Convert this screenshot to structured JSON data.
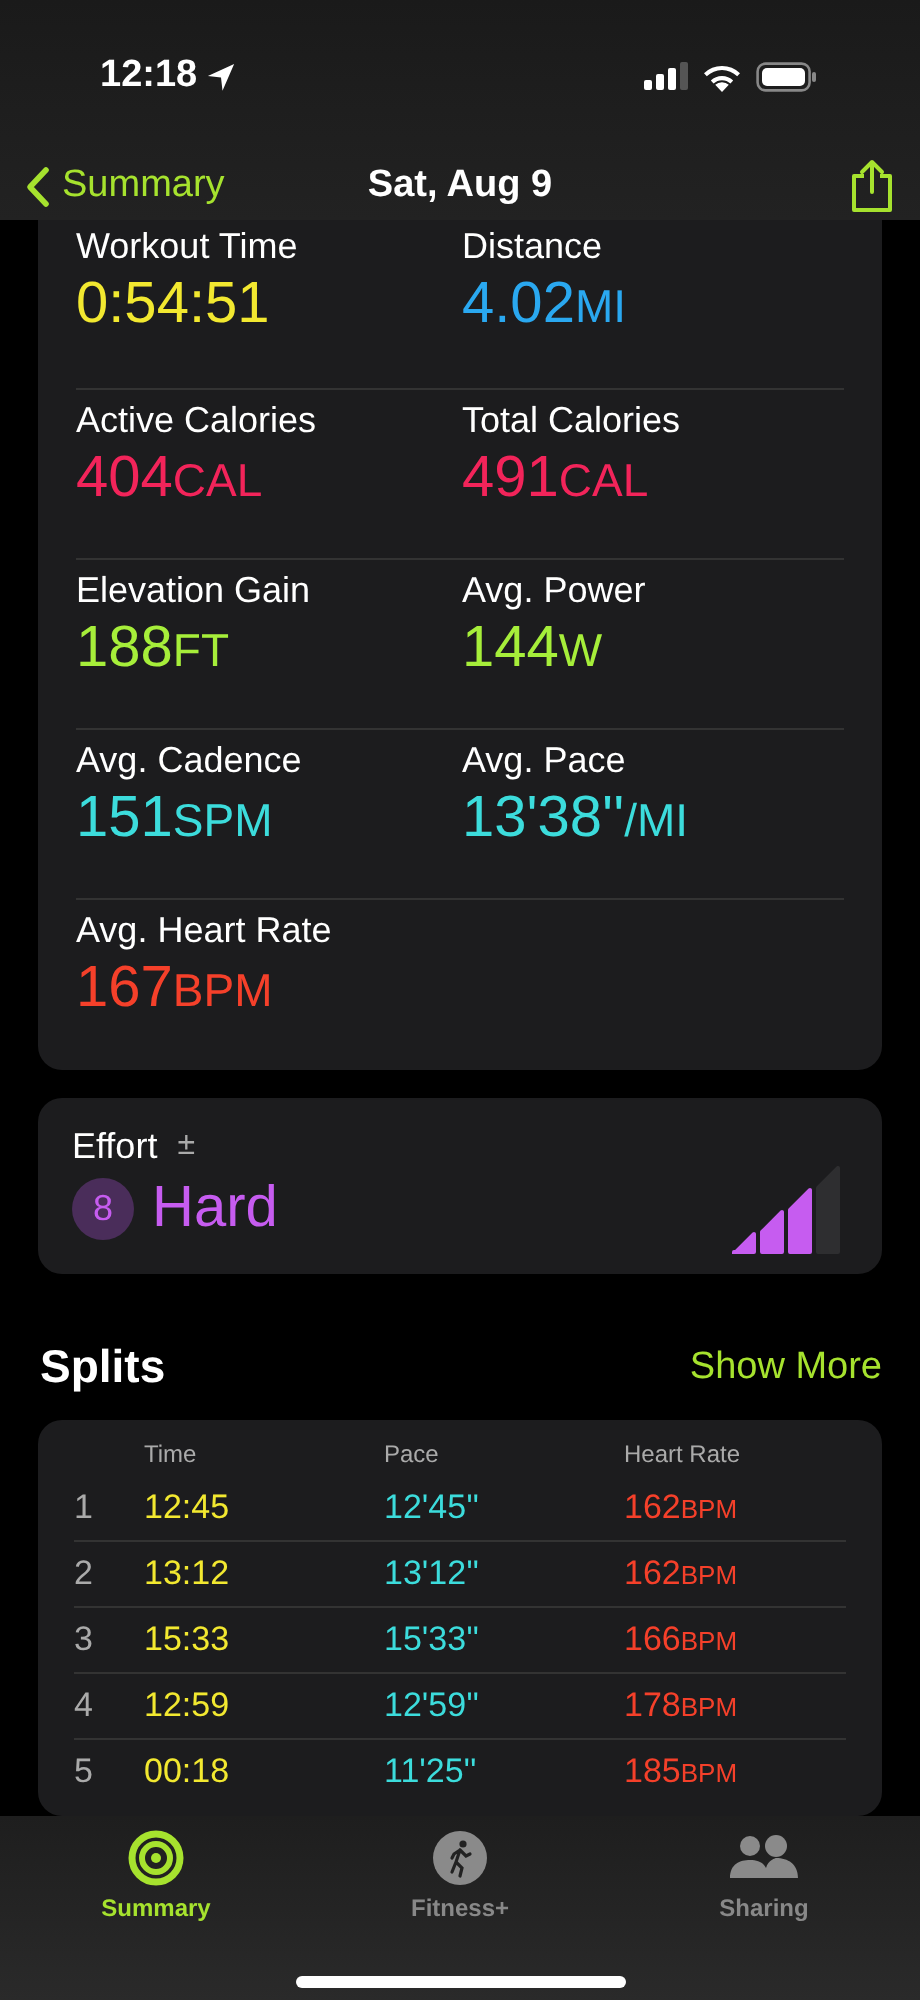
{
  "status_bar": {
    "time": "12:18"
  },
  "nav": {
    "back": "Summary",
    "title": "Sat, Aug 9"
  },
  "metrics": [
    {
      "label": "Workout Time",
      "value": "0:54:51",
      "color": "#f2e830"
    },
    {
      "label": "Distance",
      "value": "4.02",
      "unit": "MI",
      "color": "#2aa8f0"
    },
    {
      "label": "Active Calories",
      "value": "404",
      "unit": "CAL",
      "color": "#f2245a"
    },
    {
      "label": "Total Calories",
      "value": "491",
      "unit": "CAL",
      "color": "#f2245a"
    },
    {
      "label": "Elevation Gain",
      "value": "188",
      "unit": "FT",
      "color": "#a6ee3a"
    },
    {
      "label": "Avg. Power",
      "value": "144",
      "unit": "W",
      "color": "#a6ee3a"
    },
    {
      "label": "Avg. Cadence",
      "value": "151",
      "unit": "SPM",
      "color": "#3cdcdc"
    },
    {
      "label": "Avg. Pace",
      "value": "13'38''",
      "unit": "/MI",
      "color": "#3cdcdc"
    },
    {
      "label": "Avg. Heart Rate",
      "value": "167",
      "unit": "BPM",
      "color": "#f5402a"
    }
  ],
  "effort": {
    "label": "Effort",
    "symbol": "±",
    "score": "8",
    "rating": "Hard",
    "level": 0.75
  },
  "splits": {
    "title": "Splits",
    "action": "Show More",
    "columns": [
      "Time",
      "Pace",
      "Heart Rate"
    ],
    "rows": [
      {
        "index": "1",
        "time": "12:45",
        "pace": "12'45''",
        "heart_rate": "162",
        "unit": "BPM"
      },
      {
        "index": "2",
        "time": "13:12",
        "pace": "13'12''",
        "heart_rate": "162",
        "unit": "BPM"
      },
      {
        "index": "3",
        "time": "15:33",
        "pace": "15'33''",
        "heart_rate": "166",
        "unit": "BPM"
      },
      {
        "index": "4",
        "time": "12:59",
        "pace": "12'59''",
        "heart_rate": "178",
        "unit": "BPM"
      },
      {
        "index": "5",
        "time": "00:18",
        "pace": "11'25''",
        "heart_rate": "185",
        "unit": "BPM"
      }
    ]
  },
  "tab_bar": [
    {
      "label": "Summary",
      "kind": "rings",
      "selected": true
    },
    {
      "label": "Fitness+",
      "kind": "runner",
      "selected": false
    },
    {
      "label": "Sharing",
      "kind": "people",
      "selected": false
    }
  ]
}
